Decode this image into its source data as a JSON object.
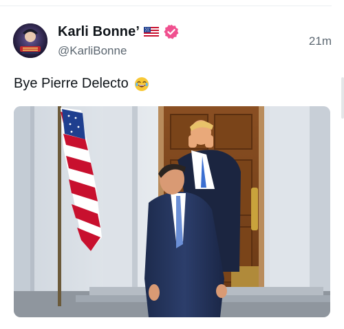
{
  "tweet": {
    "display_name": "Karli Bonne’",
    "handle": "@KarliBonne",
    "timestamp": "21m",
    "text": "Bye Pierre Delecto",
    "emoji": "joy-emoji",
    "flag": "us-flag-icon",
    "verified_color": "#f0508f"
  },
  "media": {
    "alt_icon": "photo"
  },
  "colors": {
    "text_primary": "#0f1419",
    "text_secondary": "#5b6670",
    "divider": "#ebeef0"
  }
}
